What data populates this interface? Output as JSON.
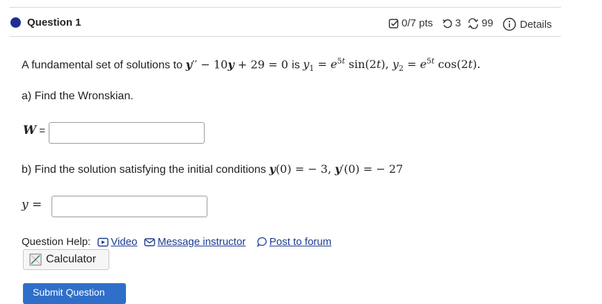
{
  "question": {
    "title": "Question 1",
    "points": "0/7 pts",
    "attempts": "3",
    "retries": "99",
    "details_label": "Details"
  },
  "problem": {
    "intro": "A fundamental set of solutions to",
    "is_text": "is",
    "part_a": "a) Find the Wronskian.",
    "part_b": "b) Find the solution satisfying the initial conditions"
  },
  "answers": {
    "wronskian_label": "W",
    "wronskian_value": "",
    "solution_label": "y",
    "solution_value": ""
  },
  "help": {
    "label": "Question Help:",
    "video": "Video",
    "message": "Message instructor",
    "forum": "Post to forum",
    "calculator": "Calculator"
  },
  "submit_label": "Submit Question",
  "icons": [
    "points-check-icon",
    "retry-icon",
    "attempts-icon",
    "info-icon",
    "video-icon",
    "mail-icon",
    "forum-icon",
    "calculator-icon"
  ],
  "colors": {
    "accent": "#1f2f8f",
    "link": "#1a3a8f",
    "button": "#2f6fc9"
  }
}
